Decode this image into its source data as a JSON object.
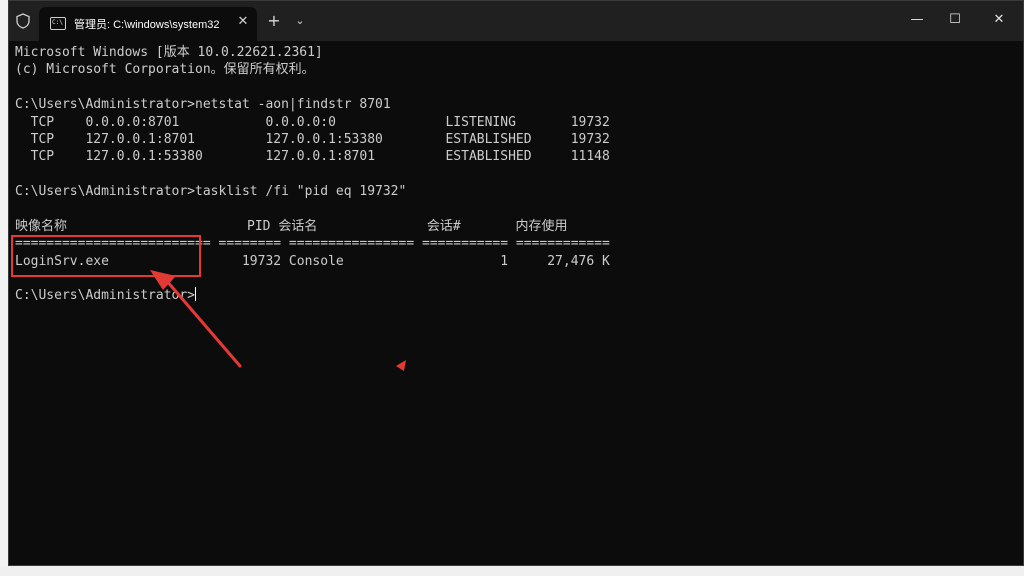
{
  "window": {
    "tab_title": "管理员: C:\\windows\\system32",
    "tab_icon_text": "C:\\",
    "new_tab_label": "+",
    "dropdown_label": "⌄",
    "close_tab_label": "✕",
    "minimize_label": "—",
    "maximize_label": "☐",
    "close_label": "✕"
  },
  "console": {
    "lines": [
      "Microsoft Windows [版本 10.0.22621.2361]",
      "(c) Microsoft Corporation。保留所有权利。",
      "",
      "C:\\Users\\Administrator>netstat -aon|findstr 8701",
      "  TCP    0.0.0.0:8701           0.0.0.0:0              LISTENING       19732",
      "  TCP    127.0.0.1:8701         127.0.0.1:53380        ESTABLISHED     19732",
      "  TCP    127.0.0.1:53380        127.0.0.1:8701         ESTABLISHED     11148",
      "",
      "C:\\Users\\Administrator>tasklist /fi \"pid eq 19732\"",
      "",
      "映像名称                       PID 会话名              会话#       内存使用",
      "========================= ======== ================ =========== ============",
      "LoginSrv.exe                 19732 Console                    1     27,476 K",
      "",
      "C:\\Users\\Administrator>"
    ]
  },
  "colors": {
    "terminal_bg": "#0c0c0c",
    "terminal_fg": "#cccccc",
    "titlebar_bg": "#202020",
    "annotation_red": "#e53935"
  }
}
